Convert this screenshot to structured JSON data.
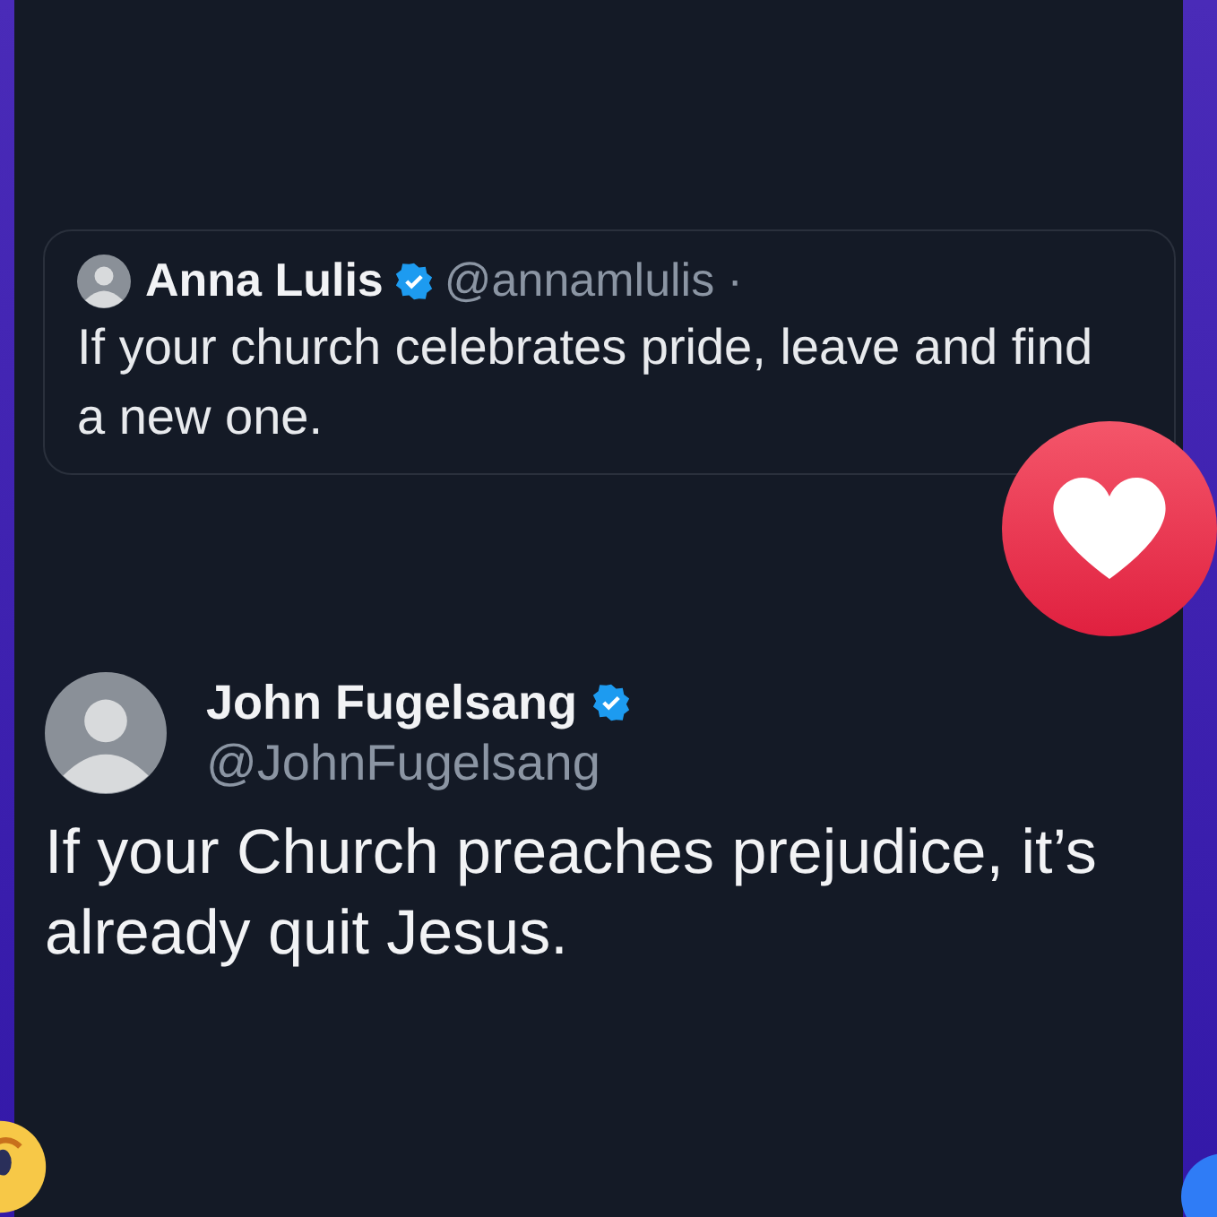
{
  "quoted_post": {
    "name": "Anna Lulis",
    "verified": true,
    "handle": "@annamlulis ·",
    "text": "If your church celebrates pride, leave and find a new one."
  },
  "post": {
    "name": "John Fugelsang",
    "verified": true,
    "handle": "@JohnFugelsang",
    "text": "If your Church preaches prejudice, it’s already quit Jesus."
  }
}
